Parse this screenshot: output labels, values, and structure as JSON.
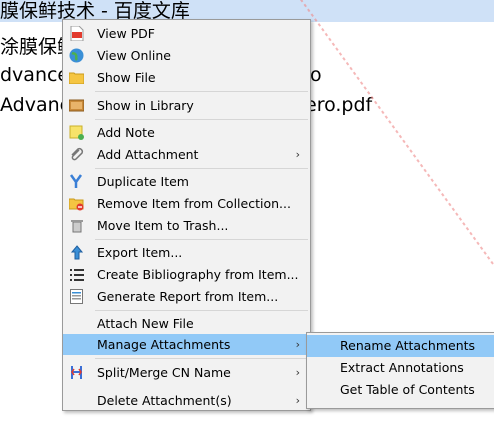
{
  "background": {
    "rows": [
      {
        "text": "膜保鲜技术 - 百度文库",
        "selected": true
      },
      {
        "text": "涂膜保鲜",
        "selected": false
      },
      {
        "text": "dvanced",
        "tail": "o",
        "selected": false
      },
      {
        "text": "Advance",
        "tail": "ero.pdf",
        "selected": false
      }
    ]
  },
  "menu": {
    "items": [
      {
        "name": "view-pdf",
        "label": "View PDF",
        "icon": "pdf-icon"
      },
      {
        "name": "view-online",
        "label": "View Online",
        "icon": "globe-icon"
      },
      {
        "name": "show-file",
        "label": "Show File",
        "icon": "folder-icon"
      },
      {
        "name": "show-in-library",
        "label": "Show in Library",
        "icon": "library-icon"
      },
      {
        "name": "add-note",
        "label": "Add Note",
        "icon": "note-icon"
      },
      {
        "name": "add-attachment",
        "label": "Add Attachment",
        "icon": "paperclip-icon",
        "submenu": true
      },
      {
        "name": "duplicate-item",
        "label": "Duplicate Item",
        "icon": "duplicate-icon"
      },
      {
        "name": "remove-from-collection",
        "label": "Remove Item from Collection...",
        "icon": "folder-remove-icon"
      },
      {
        "name": "move-to-trash",
        "label": "Move Item to Trash...",
        "icon": "trash-icon"
      },
      {
        "name": "export-item",
        "label": "Export Item...",
        "icon": "export-icon"
      },
      {
        "name": "create-bibliography",
        "label": "Create Bibliography from Item...",
        "icon": "bibliography-icon"
      },
      {
        "name": "generate-report",
        "label": "Generate Report from Item...",
        "icon": "report-icon"
      },
      {
        "name": "attach-new-file",
        "label": "Attach New File",
        "icon": ""
      },
      {
        "name": "manage-attachments",
        "label": "Manage Attachments",
        "icon": "",
        "submenu": true,
        "active": true
      },
      {
        "name": "split-merge-cn-name",
        "label": "Split/Merge CN Name",
        "icon": "split-merge-icon",
        "submenu": true
      },
      {
        "name": "delete-attachments",
        "label": "Delete Attachment(s)",
        "icon": "",
        "submenu": true
      }
    ]
  },
  "submenu": {
    "items": [
      {
        "name": "rename-attachments",
        "label": "Rename Attachments",
        "active": true
      },
      {
        "name": "extract-annotations",
        "label": "Extract Annotations"
      },
      {
        "name": "get-table-of-contents",
        "label": "Get Table of Contents"
      }
    ]
  },
  "colors": {
    "menu_bg": "#f2f2f2",
    "highlight": "#91c9f7",
    "selected_row": "#cfe1f7"
  },
  "arrow_glyph": "›"
}
